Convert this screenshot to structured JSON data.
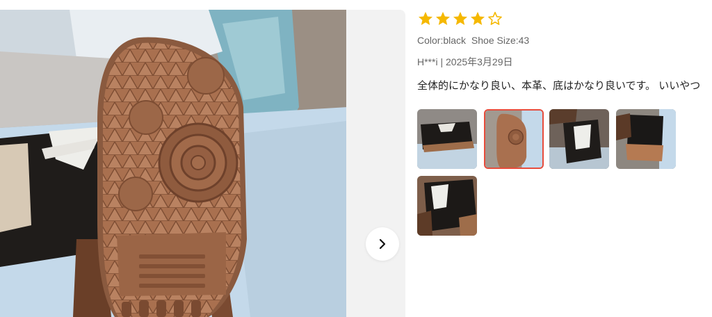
{
  "review": {
    "rating": 4,
    "rating_max": 5,
    "color_label": "Color:black",
    "size_label": "Shoe Size:43",
    "author": "H***i",
    "separator": "|",
    "date": "2025年3月29日",
    "text": "全体的にかなり良い、本革、底はかなり良いです。 いいやつ"
  },
  "gallery": {
    "selected_index": 1,
    "thumbnail_count": 5,
    "next_icon": "chevron-right-icon"
  },
  "colors": {
    "star": "#f5b800",
    "selected_border": "#e74c3c",
    "viewer_bg": "#f2f2f2"
  }
}
